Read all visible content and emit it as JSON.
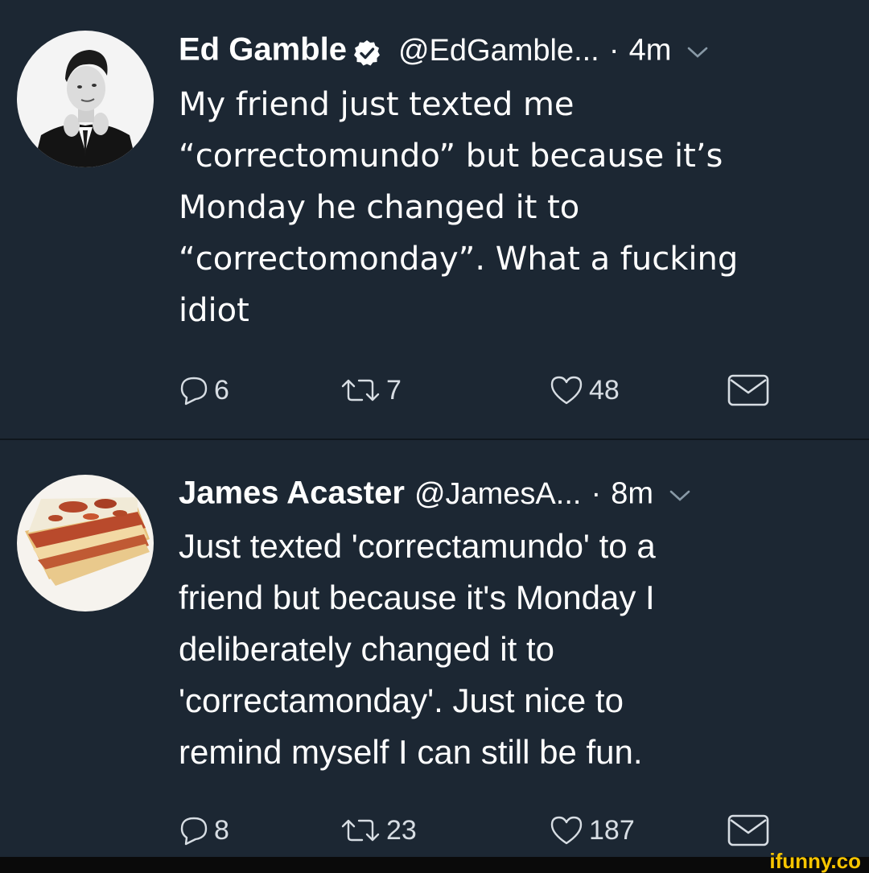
{
  "tweets": [
    {
      "display_name": "Ed Gamble",
      "verified": true,
      "handle": "@EdGamble...",
      "separator": "·",
      "time": "4m",
      "text": "My friend just texted me\n“correctomundo” but because it’s\nMonday he changed it to\n“correctomonday”. What a fucking\nidiot",
      "avatar_icon": "man-in-suit-photo",
      "counts": {
        "replies": "6",
        "retweets": "7",
        "likes": "48"
      }
    },
    {
      "display_name": "James Acaster",
      "verified": false,
      "handle": "@JamesA...",
      "separator": "·",
      "time": "8m",
      "text": "Just texted 'correctamundo' to a\nfriend but because it's Monday I\ndeliberately changed it to\n'correctamonday'. Just nice to\nremind myself I can still be fun.",
      "avatar_icon": "lasagna-photo",
      "counts": {
        "replies": "8",
        "retweets": "23",
        "likes": "187"
      }
    }
  ],
  "icons": {
    "reply": "reply-icon",
    "retweet": "retweet-icon",
    "like": "heart-icon",
    "dm": "envelope-icon",
    "more": "chevron-down-icon",
    "verified": "verified-badge-icon"
  },
  "colors": {
    "background": "#1c2733",
    "text": "#ffffff",
    "icon": "#d7dde3",
    "verified_badge": "#ffffff",
    "watermark": "#f7c500"
  },
  "watermark": "ifunny.co"
}
